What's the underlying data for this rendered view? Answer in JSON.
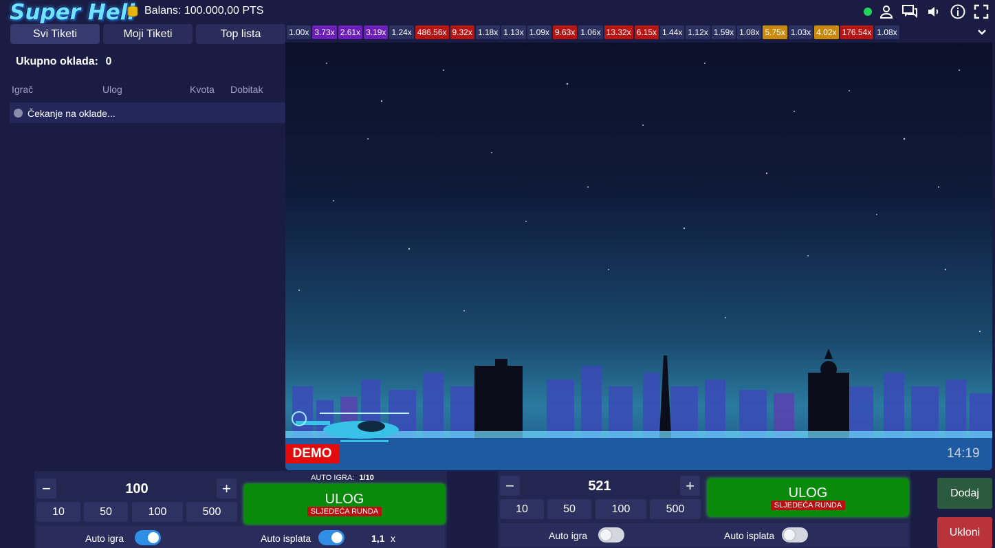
{
  "header": {
    "logo_text": "Super Heli",
    "balance": "Balans: 100.000,00 PTS",
    "status_color": "#1fd65a",
    "icons": [
      "user-icon",
      "chat-icon",
      "sound-icon",
      "info-icon",
      "fullscreen-icon"
    ]
  },
  "tabs": [
    {
      "label": "Svi Tiketi"
    },
    {
      "label": "Moji Tiketi"
    },
    {
      "label": "Top lista"
    }
  ],
  "bets_list": {
    "total_label": "Ukupno oklada:",
    "total_value": "0",
    "columns": [
      "Igrač",
      "Ulog",
      "Kvota",
      "Dobitak"
    ],
    "waiting_text": "Čekanje na oklade..."
  },
  "multipliers": [
    {
      "value": "1.00x",
      "color": "#2c3260"
    },
    {
      "value": "3.73x",
      "color": "#6b1fb8"
    },
    {
      "value": "2.61x",
      "color": "#6b1fb8"
    },
    {
      "value": "3.19x",
      "color": "#6b1fb8"
    },
    {
      "value": "1.24x",
      "color": "#2c3260"
    },
    {
      "value": "486.56x",
      "color": "#b71414"
    },
    {
      "value": "9.32x",
      "color": "#b71414"
    },
    {
      "value": "1.18x",
      "color": "#2c3260"
    },
    {
      "value": "1.13x",
      "color": "#2c3260"
    },
    {
      "value": "1.09x",
      "color": "#2c3260"
    },
    {
      "value": "9.63x",
      "color": "#b71414"
    },
    {
      "value": "1.06x",
      "color": "#2c3260"
    },
    {
      "value": "13.32x",
      "color": "#b71414"
    },
    {
      "value": "6.15x",
      "color": "#b71414"
    },
    {
      "value": "1.44x",
      "color": "#2c3260"
    },
    {
      "value": "1.12x",
      "color": "#2c3260"
    },
    {
      "value": "1.59x",
      "color": "#2c3260"
    },
    {
      "value": "1.08x",
      "color": "#2c3260"
    },
    {
      "value": "5.75x",
      "color": "#c98a0c"
    },
    {
      "value": "1.03x",
      "color": "#2c3260"
    },
    {
      "value": "4.02x",
      "color": "#c98a0c"
    },
    {
      "value": "176.54x",
      "color": "#b71414"
    },
    {
      "value": "1.08x",
      "color": "#2c3260"
    }
  ],
  "game": {
    "demo_label": "DEMO",
    "clock": "14:19"
  },
  "bet1": {
    "auto_play_label": "AUTO IGRA:",
    "auto_play_count": "1/10",
    "amount": "100",
    "quick": [
      "10",
      "50",
      "100",
      "500"
    ],
    "button_title": "ULOG",
    "button_sub": "SLJEDEĆA RUNDA",
    "auto_igra_label": "Auto igra",
    "auto_igra_on": true,
    "auto_isplata_label": "Auto isplata",
    "auto_isplata_on": true,
    "cashout_value": "1,1",
    "cashout_suffix": "x"
  },
  "bet2": {
    "amount": "521",
    "quick": [
      "10",
      "50",
      "100",
      "500"
    ],
    "button_title": "ULOG",
    "button_sub": "SLJEDEĆA RUNDA",
    "auto_igra_label": "Auto igra",
    "auto_igra_on": false,
    "auto_isplata_label": "Auto isplata",
    "auto_isplata_on": false
  },
  "side": {
    "add_label": "Dodaj",
    "remove_label": "Ukloni"
  }
}
